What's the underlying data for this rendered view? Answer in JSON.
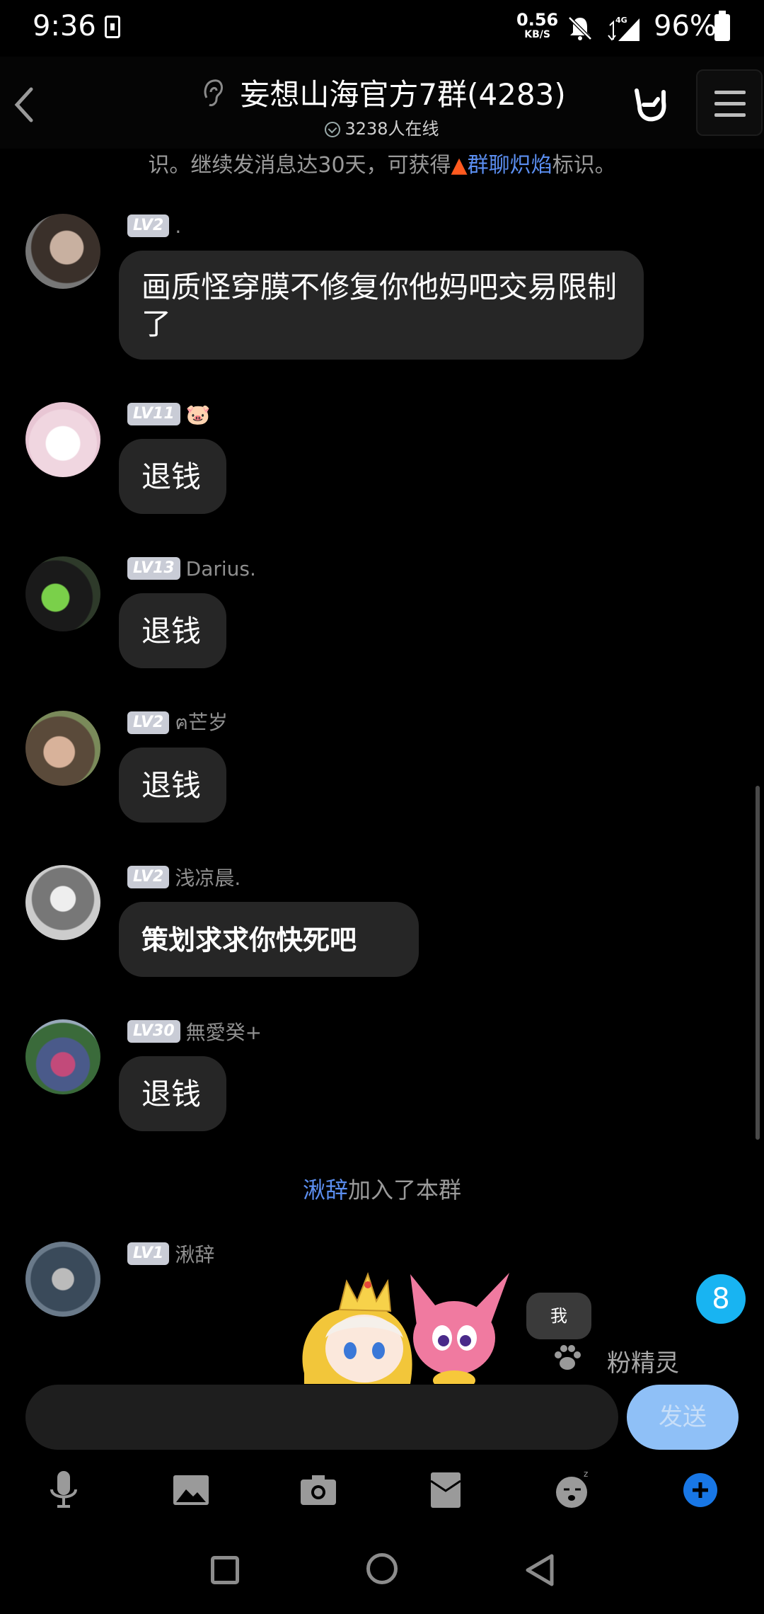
{
  "status_bar": {
    "time": "9:36",
    "speed_value": "0.56",
    "speed_unit": "KB/S",
    "network": "4G",
    "battery": "96%"
  },
  "header": {
    "title": "妄想山海官方7群(4283)",
    "online": "3238人在线"
  },
  "notice": {
    "prefix": "识。继续发消息达30天，可获得",
    "link": "群聊炽焰",
    "suffix": "标识。"
  },
  "messages": [
    {
      "level": "LV2",
      "nick": ".",
      "text": "画质怪穿膜不修复你他妈吧交易限制了"
    },
    {
      "level": "LV11",
      "nick": "🐷",
      "text": "退钱"
    },
    {
      "level": "LV13",
      "nick": "Darius.",
      "text": "退钱"
    },
    {
      "level": "LV2",
      "nick": "ฅ芒岁",
      "text": "退钱"
    },
    {
      "level": "LV2",
      "nick": "浅凉晨.",
      "text": "策划求求你快死吧"
    },
    {
      "level": "LV30",
      "nick": "無愛癸+",
      "text": "退钱"
    },
    {
      "level": "LV1",
      "nick": "湫辞",
      "text": ""
    }
  ],
  "system_message": {
    "name": "湫辞",
    "text": "加入了本群"
  },
  "sticker_popup": {
    "me_label": "我",
    "fairy_label": "粉精灵"
  },
  "unread_count": "8",
  "composer": {
    "placeholder": "",
    "send_label": "发送"
  },
  "colors": {
    "accent": "#5b8ef0",
    "send_button": "#8fc0f7",
    "unread_badge": "#18b4f2",
    "bubble": "#262626"
  }
}
